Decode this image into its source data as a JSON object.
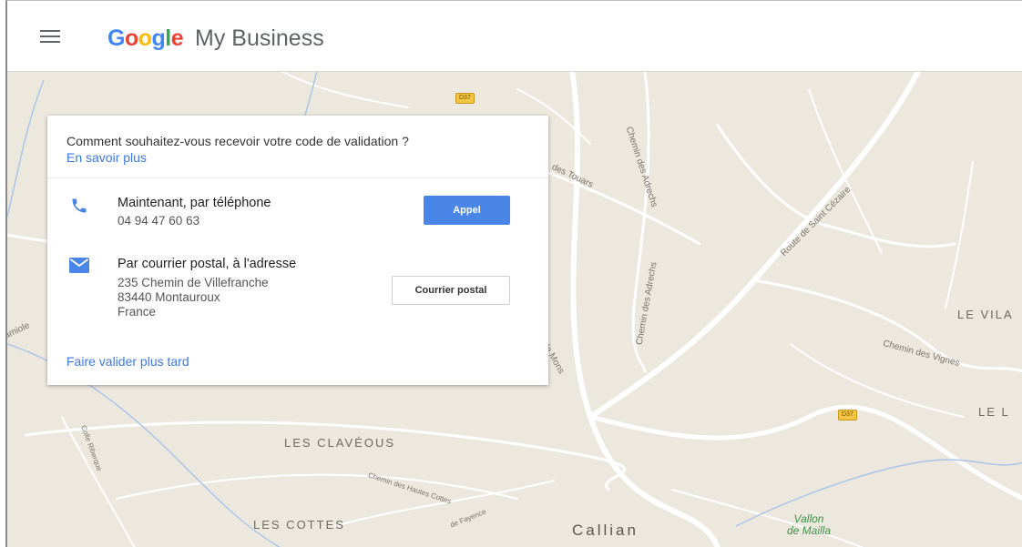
{
  "header": {
    "logo_letters": [
      "G",
      "o",
      "o",
      "g",
      "l",
      "e"
    ],
    "product": "My Business",
    "menu_icon": "hamburger-menu-icon"
  },
  "dialog": {
    "question": "Comment souhaitez-vous recevoir votre code de validation ?",
    "learn_more": "En savoir plus",
    "phone_option": {
      "icon": "phone-icon",
      "title": "Maintenant, par téléphone",
      "number": "04 94 47 60 63",
      "button": "Appel"
    },
    "mail_option": {
      "icon": "mail-icon",
      "title": "Par courrier postal, à l'adresse",
      "address": [
        "235 Chemin de Villefranche",
        "83440 Montauroux",
        "France"
      ],
      "button": "Courrier postal"
    },
    "later_link": "Faire valider plus tard"
  },
  "map": {
    "labels": {
      "chemin_des_touars": "des Touars",
      "chemin_des_adrechs_1": "Chemin des Adrechs",
      "chemin_des_adrechs_2": "Chemin des Adrechs",
      "route_de_saint_cezaire": "Route de Saint Cézaire",
      "de_mons": "de Mons",
      "chemin_des_vignes": "Chemin des Vignes",
      "chemin_des_hautes_cottes": "Chemin des Hautes Cottes",
      "de_fayence": "de Fayence",
      "colle_riberque": "Colle Riberque",
      "amiole": "amiole"
    },
    "places": {
      "les_claveous": "LES CLAVÉOUS",
      "les_cottes": "LES COTTES",
      "le_vila": "LE VILA",
      "le_l": "LE L"
    },
    "town": "Callian",
    "green_area": [
      "Vallon",
      "de Mailla"
    ],
    "road_shields": [
      "D37",
      "D37"
    ]
  },
  "colors": {
    "primary_button": "#4a86e8",
    "link": "#3b78e7",
    "map_background": "#ece8de"
  }
}
